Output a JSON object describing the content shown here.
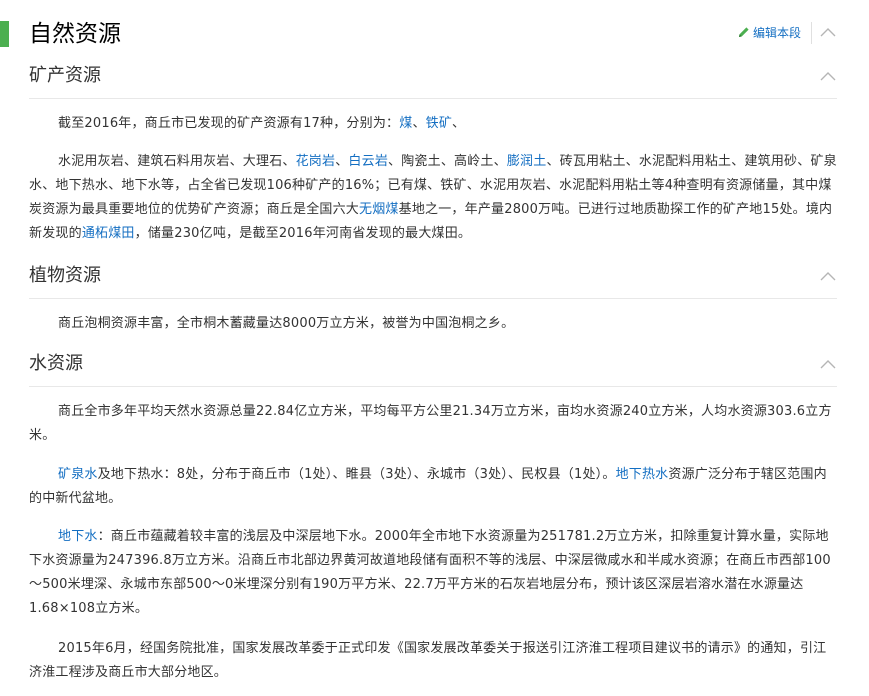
{
  "title": "自然资源",
  "edit_label": "编辑本段",
  "icons": {
    "edit": "pencil-icon",
    "collapse": "chevron-up-icon"
  },
  "colors": {
    "accent": "#4caf50",
    "link": "#136ec2",
    "text": "#333333"
  },
  "sections": [
    {
      "title": "矿产资源",
      "paragraphs": [
        [
          {
            "t": "截至2016年，商丘市已发现的矿产资源有17种，分别为："
          },
          {
            "t": "煤",
            "link": true
          },
          {
            "t": "、"
          },
          {
            "t": "铁矿",
            "link": true
          },
          {
            "t": "、"
          }
        ],
        [
          {
            "t": "水泥用灰岩、建筑石料用灰岩、大理石、"
          },
          {
            "t": "花岗岩",
            "link": true
          },
          {
            "t": "、"
          },
          {
            "t": "白云岩",
            "link": true
          },
          {
            "t": "、陶瓷土、高岭土、"
          },
          {
            "t": "膨润土",
            "link": true
          },
          {
            "t": "、砖瓦用粘土、水泥配料用粘土、建筑用砂、矿泉水、地下热水、地下水等，占全省已发现106种矿产的16%；已有煤、铁矿、水泥用灰岩、水泥配料用粘土等4种查明有资源储量，其中煤炭资源为最具重要地位的优势矿产资源；商丘是全国六大"
          },
          {
            "t": "无烟煤",
            "link": true
          },
          {
            "t": "基地之一，年产量2800万吨。已进行过地质勘探工作的矿产地15处。境内新发现的"
          },
          {
            "t": "通柘煤田",
            "link": true
          },
          {
            "t": "，储量230亿吨，是截至2016年河南省发现的最大煤田。"
          }
        ]
      ]
    },
    {
      "title": "植物资源",
      "paragraphs": [
        [
          {
            "t": "商丘泡桐资源丰富，全市桐木蓄藏量达8000万立方米，被誉为中国泡桐之乡。"
          }
        ]
      ]
    },
    {
      "title": "水资源",
      "paragraphs": [
        [
          {
            "t": "商丘全市多年平均天然水资源总量22.84亿立方米，平均每平方公里21.34万立方米，亩均水资源240立方米，人均水资源303.6立方米。"
          }
        ],
        [
          {
            "t": "矿泉水",
            "link": true
          },
          {
            "t": "及地下热水：8处，分布于商丘市（1处）、睢县（3处）、永城市（3处）、民权县（1处）。"
          },
          {
            "t": "地下热水",
            "link": true
          },
          {
            "t": "资源广泛分布于辖区范围内的中新代盆地。"
          }
        ],
        [
          {
            "t": "地下水",
            "link": true
          },
          {
            "t": "：商丘市蕴藏着较丰富的浅层及中深层地下水。2000年全市地下水资源量为251781.2万立方米，扣除重复计算水量，实际地下水资源量为247396.8万立方米。沿商丘市北部边界黄河故道地段储有面积不等的浅层、中深层微咸水和半咸水资源；在商丘市西部100～500米埋深、永城市东部500～0米埋深分别有190万平方米、22.7万平方米的石灰岩地层分布，预计该区深层岩溶水潜在水源量达1.68×108立方米。"
          }
        ],
        [
          {
            "t": "2015年6月，经国务院批准，国家发展改革委于正式印发《国家发展改革委关于报送引江济淮工程项目建议书的请示》的通知，引江济淮工程涉及商丘市大部分地区。"
          }
        ]
      ]
    }
  ]
}
